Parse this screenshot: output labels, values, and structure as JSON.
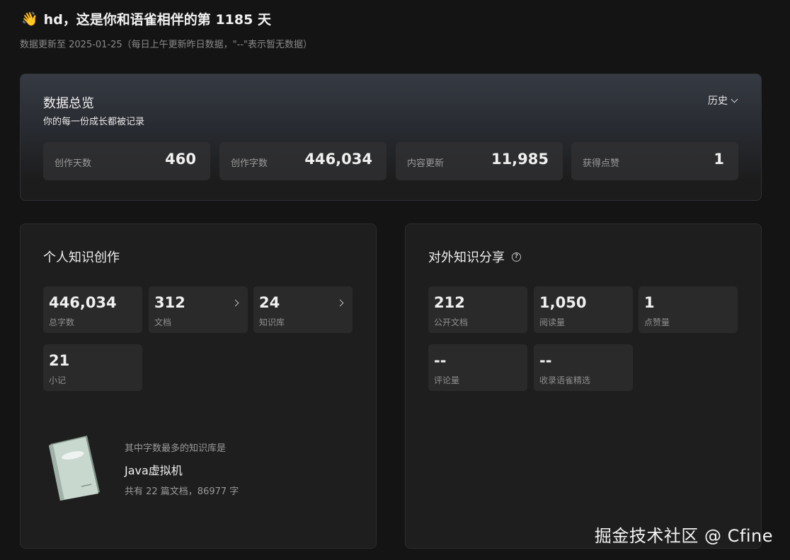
{
  "greeting": {
    "emoji": "👋",
    "prefix": "hd，这是你和语雀相伴的第",
    "days": "1185",
    "suffix": "天"
  },
  "subtitle": "数据更新至 2025-01-25（每日上午更新昨日数据，\"--\"表示暂无数据）",
  "overview": {
    "title": "数据总览",
    "subtitle": "你的每一份成长都被记录",
    "history_label": "历史",
    "stats": [
      {
        "label": "创作天数",
        "value": "460"
      },
      {
        "label": "创作字数",
        "value": "446,034"
      },
      {
        "label": "内容更新",
        "value": "11,985"
      },
      {
        "label": "获得点赞",
        "value": "1"
      }
    ]
  },
  "personal": {
    "title": "个人知识创作",
    "tiles": [
      {
        "value": "446,034",
        "label": "总字数"
      },
      {
        "value": "312",
        "label": "文档"
      },
      {
        "value": "24",
        "label": "知识库"
      },
      {
        "value": "21",
        "label": "小记"
      }
    ],
    "top_library": {
      "hint": "其中字数最多的知识库是",
      "name": "Java虚拟机",
      "detail": "共有 22 篇文档，86977 字"
    }
  },
  "external": {
    "title": "对外知识分享",
    "help_icon": "question-circle-icon",
    "tiles": [
      {
        "value": "212",
        "label": "公开文档"
      },
      {
        "value": "1,050",
        "label": "阅读量"
      },
      {
        "value": "1",
        "label": "点赞量"
      },
      {
        "value": "--",
        "label": "评论量"
      },
      {
        "value": "--",
        "label": "收录语雀精选"
      }
    ]
  },
  "watermark": "掘金技术社区 @ Cfine"
}
